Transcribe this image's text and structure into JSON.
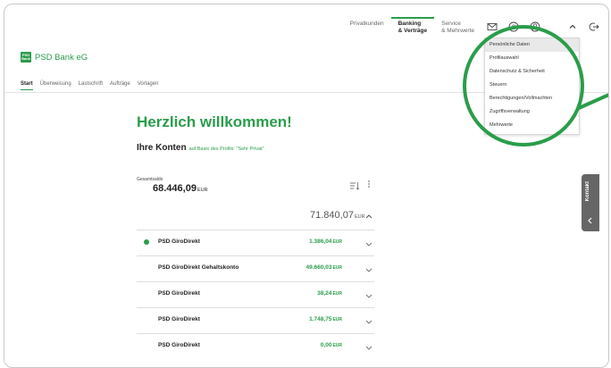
{
  "top_nav": {
    "privatkunden": "Privatkunden",
    "banking_line1": "Banking",
    "banking_line2": "& Verträge",
    "service_line1": "Service",
    "service_line2": "& Mehrwerte"
  },
  "icons": {
    "mail": "mail-icon",
    "help": "help-icon",
    "user": "user-icon",
    "chevron_up": "chevron-up-icon",
    "logout": "logout-icon"
  },
  "logo": {
    "box_line1": "PSD",
    "box_line2": "Bank",
    "text": "PSD Bank eG"
  },
  "sub_nav": [
    "Start",
    "Überweisung",
    "Lastschrift",
    "Aufträge",
    "Vorlagen"
  ],
  "main": {
    "welcome": "Herzlich willkommen!",
    "konten_title": "Ihre Konten",
    "basis_text": "auf Basis des Profils: \"Sehr Privat\"",
    "gesamtsaldo_label": "Gesamtsaldo",
    "gesamtsaldo_value": "68.446,09",
    "currency": "EUR",
    "group_total": "71.840,07"
  },
  "accounts": [
    {
      "name": "PSD GiroDirekt",
      "amount": "1.386,04",
      "primary": true
    },
    {
      "name": "PSD GiroDirekt Gehaltskonto",
      "amount": "49.660,03",
      "primary": false
    },
    {
      "name": "PSD GiroDirekt",
      "amount": "38,24",
      "primary": false
    },
    {
      "name": "PSD GiroDirekt",
      "amount": "1.748,75",
      "primary": false
    },
    {
      "name": "PSD GiroDirekt",
      "amount": "0,00",
      "primary": false
    }
  ],
  "dropdown": {
    "items": [
      "Persönliche Daten",
      "Profilauswahl",
      "Datenschutz & Sicherheit",
      "Steuern",
      "Berechtigungen/Vollmachten",
      "Zugriffsverwaltung",
      "Mehrwerte"
    ]
  },
  "kontakt": {
    "label": "Kontakt"
  },
  "colors": {
    "accent": "#2a9d4a",
    "kontakt_bg": "#666666"
  }
}
